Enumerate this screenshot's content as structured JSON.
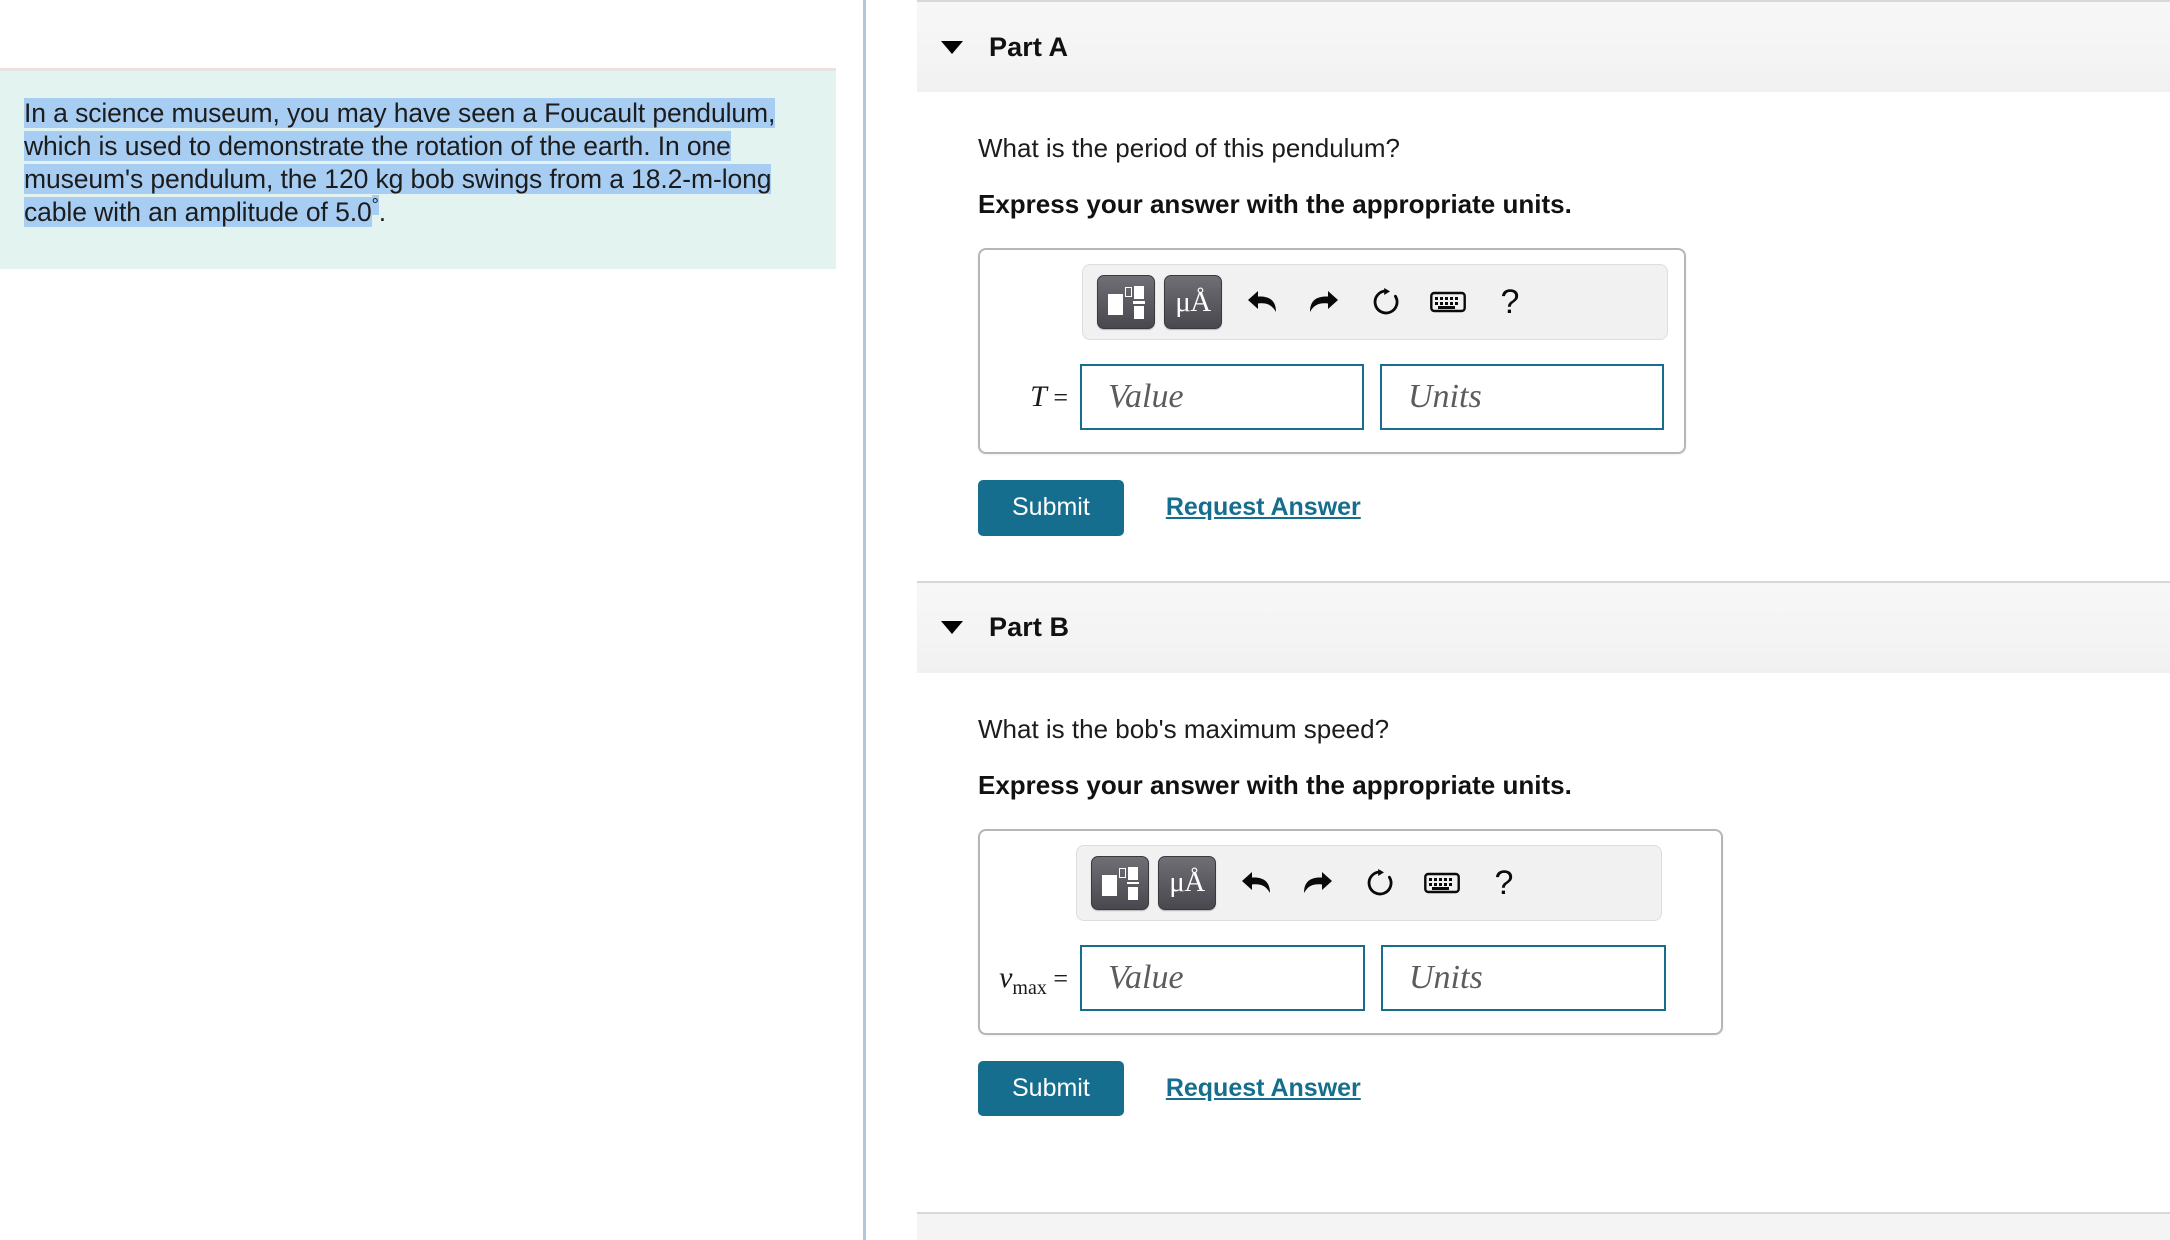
{
  "problem": {
    "text_before_selection": "",
    "selected_text": "In a science museum, you may have seen a Foucault pendulum, which is used to demonstrate the rotation of the earth. In one museum's pendulum, the 120 kg bob swings from a 18.2-m-long cable with an amplitude of 5.0",
    "degree_symbol": "°",
    "trailing_text": ".",
    "line1": "In a science museum, you may have seen a Foucault pendulum,",
    "line2": "which is used to demonstrate the rotation of the earth. In one",
    "line3": "museum's pendulum, the 120 kg bob swings from a 18.2-m-long",
    "line4": "cable with an amplitude of 5.0",
    "highlight_color": "#a8cdf2",
    "background_color": "#e3f3f0"
  },
  "parts": [
    {
      "id": "part-a",
      "title": "Part A",
      "caret": "chevron-down-icon",
      "question": "What is the period of this pendulum?",
      "instruction": "Express your answer with the appropriate units.",
      "variable_label": "T",
      "variable_subscript": "",
      "equals": "=",
      "value_placeholder": "Value",
      "units_placeholder": "Units",
      "value_text": "",
      "units_text": "",
      "submit_label": "Submit",
      "request_answer_label": "Request Answer",
      "toolbar": [
        {
          "name": "math-template-icon",
          "label": ""
        },
        {
          "name": "units-micro-angstrom-icon",
          "label": "μÅ"
        },
        {
          "name": "undo-icon",
          "label": ""
        },
        {
          "name": "redo-icon",
          "label": ""
        },
        {
          "name": "reset-icon",
          "label": ""
        },
        {
          "name": "keyboard-icon",
          "label": ""
        },
        {
          "name": "help-icon",
          "label": "?"
        }
      ]
    },
    {
      "id": "part-b",
      "title": "Part B",
      "caret": "chevron-down-icon",
      "question": "What is the bob's maximum speed?",
      "instruction": "Express your answer with the appropriate units.",
      "variable_label": "v",
      "variable_subscript": "max",
      "equals": "=",
      "value_placeholder": "Value",
      "units_placeholder": "Units",
      "value_text": "",
      "units_text": "",
      "submit_label": "Submit",
      "request_answer_label": "Request Answer",
      "toolbar": [
        {
          "name": "math-template-icon",
          "label": ""
        },
        {
          "name": "units-micro-angstrom-icon",
          "label": "μÅ"
        },
        {
          "name": "undo-icon",
          "label": ""
        },
        {
          "name": "redo-icon",
          "label": ""
        },
        {
          "name": "reset-icon",
          "label": ""
        },
        {
          "name": "keyboard-icon",
          "label": ""
        },
        {
          "name": "help-icon",
          "label": "?"
        }
      ]
    }
  ],
  "colors": {
    "accent": "#156e8e",
    "field_border": "#186d8c",
    "panel_divider": "#b3c6da",
    "header_bg": "#f4f4f4"
  }
}
